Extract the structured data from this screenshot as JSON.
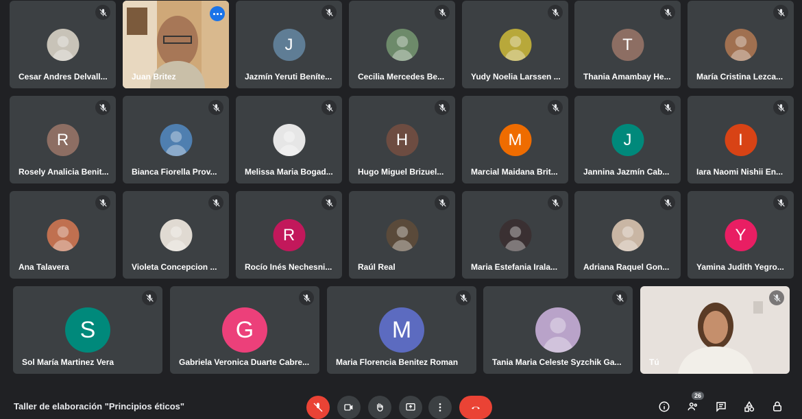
{
  "participants": [
    {
      "name": "Cesar Andres Delvall...",
      "avatar": "photo",
      "photo_color": "#c8c3b8"
    },
    {
      "name": "Juan Britez",
      "avatar": "video",
      "speaking": true
    },
    {
      "name": "Jazmín Yeruti Beníte...",
      "avatar": "letter",
      "initial": "J",
      "color": "#5f7d95"
    },
    {
      "name": "Cecilia Mercedes Be...",
      "avatar": "photo",
      "photo_color": "#6d8a6a"
    },
    {
      "name": "Yudy Noelia Larssen ...",
      "avatar": "photo",
      "photo_color": "#b8a83a"
    },
    {
      "name": "Thania Amambay He...",
      "avatar": "letter",
      "initial": "T",
      "color": "#8d6e63"
    },
    {
      "name": "María Cristina Lezca...",
      "avatar": "photo",
      "photo_color": "#a07050"
    },
    {
      "name": "Rosely Analicia Benit...",
      "avatar": "letter",
      "initial": "R",
      "color": "#8d6e63"
    },
    {
      "name": "Bianca Fiorella Prov...",
      "avatar": "photo",
      "photo_color": "#4f7fb0"
    },
    {
      "name": "Melissa Maria Bogad...",
      "avatar": "photo",
      "photo_color": "#e6e6e6"
    },
    {
      "name": "Hugo Miguel Brizuel...",
      "avatar": "letter",
      "initial": "H",
      "color": "#6d4c41"
    },
    {
      "name": "Marcial Maidana Brit...",
      "avatar": "letter",
      "initial": "M",
      "color": "#ef6c00"
    },
    {
      "name": "Jannina Jazmín Cab...",
      "avatar": "letter",
      "initial": "J",
      "color": "#00897b"
    },
    {
      "name": "Iara Naomi Nishii En...",
      "avatar": "letter",
      "initial": "I",
      "color": "#d84315"
    },
    {
      "name": "Ana Talavera",
      "avatar": "photo",
      "photo_color": "#c07050"
    },
    {
      "name": "Violeta Concepcion ...",
      "avatar": "photo",
      "photo_color": "#e0dad2"
    },
    {
      "name": "Rocío Inés Nechesni...",
      "avatar": "letter",
      "initial": "R",
      "color": "#c2185b"
    },
    {
      "name": "Raúl Real",
      "avatar": "photo",
      "photo_color": "#5a4a3a"
    },
    {
      "name": "Maria Estefania Irala...",
      "avatar": "photo",
      "photo_color": "#3a3032"
    },
    {
      "name": "Adriana Raquel Gon...",
      "avatar": "photo",
      "photo_color": "#c9b6a4"
    },
    {
      "name": "Yamina Judith Yegro...",
      "avatar": "letter",
      "initial": "Y",
      "color": "#e91e63"
    },
    {
      "name": "Sol María Martinez Vera",
      "avatar": "letter",
      "initial": "S",
      "color": "#00897b"
    },
    {
      "name": "Gabriela Veronica Duarte Cabre...",
      "avatar": "letter",
      "initial": "G",
      "color": "#ec407a"
    },
    {
      "name": "Maria Florencia Benitez Roman",
      "avatar": "letter",
      "initial": "M",
      "color": "#5c6bc0"
    },
    {
      "name": "Tania Maria Celeste Syzchik Ga...",
      "avatar": "photo",
      "photo_color": "#b9a3c9"
    },
    {
      "name": "Tú",
      "avatar": "self-video"
    }
  ],
  "meeting": {
    "title": "Taller de elaboración \"Principios éticos\""
  },
  "controls": {
    "participants_count": "26"
  },
  "colors": {
    "background": "#202124",
    "tile": "#3c4043",
    "accent": "#8ab4f8",
    "danger": "#ea4335"
  },
  "icons": [
    "mic-off-icon",
    "camera-icon",
    "raise-hand-icon",
    "present-icon",
    "more-vert-icon",
    "hangup-icon",
    "info-icon",
    "people-icon",
    "chat-icon",
    "activities-icon",
    "lock-icon"
  ]
}
